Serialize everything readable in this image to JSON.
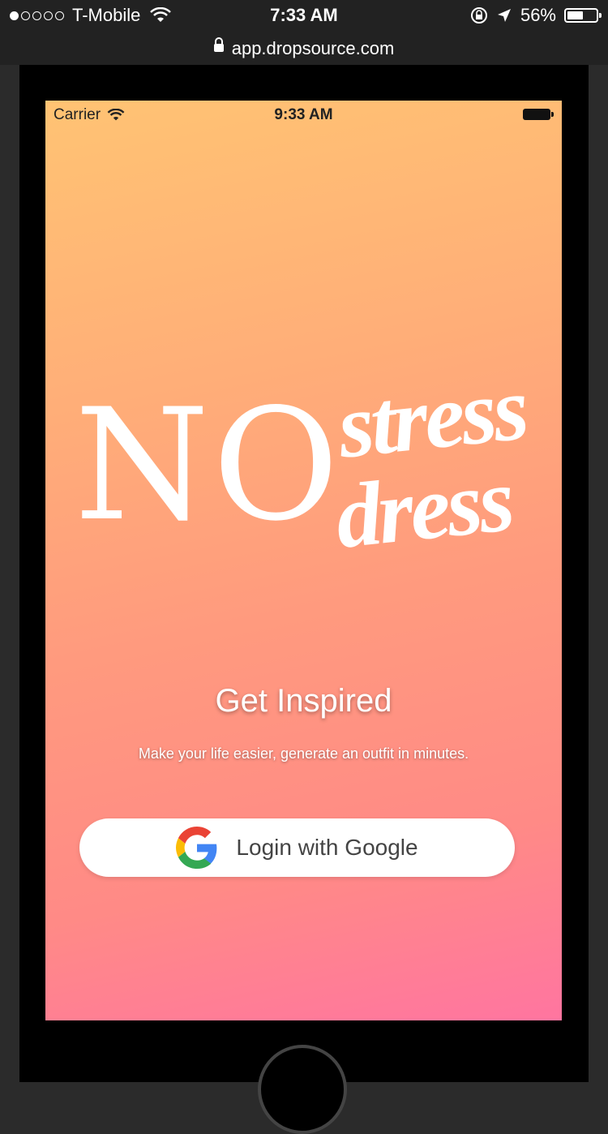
{
  "device_status": {
    "carrier": "T-Mobile",
    "time": "7:33 AM",
    "battery": "56%",
    "signal_dots_filled": 1,
    "signal_dots_total": 5
  },
  "browser": {
    "url": "app.dropsource.com"
  },
  "app_status": {
    "carrier": "Carrier",
    "time": "9:33 AM"
  },
  "logo": {
    "word_no": "NO",
    "word_stress": "stress",
    "word_dress": "dress"
  },
  "hero": {
    "title": "Get Inspired",
    "subtitle": "Make your life easier, generate an outfit in minutes."
  },
  "login": {
    "google_label": "Login with Google"
  },
  "colors": {
    "gradient_top": "#ffc373",
    "gradient_bottom": "#ff75a0",
    "button_bg": "#ffffff"
  }
}
